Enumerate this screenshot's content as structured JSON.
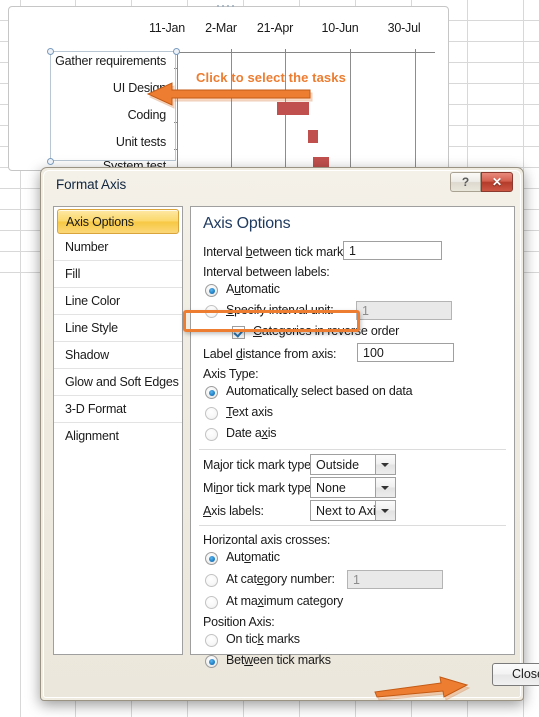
{
  "chart": {
    "callout": "Click to select the tasks",
    "x_axis_labels": [
      "11-Jan",
      "2-Mar",
      "21-Apr",
      "10-Jun",
      "30-Jul"
    ],
    "category_labels": [
      "Gather requirements",
      "UI Design",
      "Coding",
      "Unit tests",
      "System test"
    ],
    "bar_color": "#c0504d",
    "accent_color": "#ED7D31"
  },
  "chart_data": {
    "type": "bar",
    "title": "",
    "categories": [
      "Gather requirements",
      "UI Design",
      "Coding",
      "Unit tests",
      "System test"
    ],
    "values": [
      0,
      0,
      30,
      10,
      14
    ],
    "xlabel": "",
    "ylabel": "",
    "tick_labels": [
      "11-Jan",
      "2-Mar",
      "21-Apr",
      "10-Jun",
      "30-Jul"
    ],
    "grid": true,
    "legend": "none"
  },
  "dialog": {
    "title": "Format Axis",
    "help_label": "?",
    "close_x_label": "✕",
    "close_label": "Close",
    "nav": {
      "items": [
        {
          "label": "Axis Options",
          "selected": true
        },
        {
          "label": "Number",
          "selected": false
        },
        {
          "label": "Fill",
          "selected": false
        },
        {
          "label": "Line Color",
          "selected": false
        },
        {
          "label": "Line Style",
          "selected": false
        },
        {
          "label": "Shadow",
          "selected": false
        },
        {
          "label": "Glow and Soft Edges",
          "selected": false
        },
        {
          "label": "3-D Format",
          "selected": false
        },
        {
          "label": "Alignment",
          "selected": false
        }
      ]
    },
    "pane": {
      "heading": "Axis Options",
      "interval_tick_label": "Interval between tick marks:",
      "interval_tick_value": "1",
      "interval_labels_label": "Interval between labels:",
      "interval_labels_automatic": "Automatic",
      "interval_labels_specify": "Specify interval unit:",
      "interval_labels_specify_value": "1",
      "categories_reverse": "Categories in reverse order",
      "label_distance_label": "Label distance from axis:",
      "label_distance_value": "100",
      "axis_type_label": "Axis Type:",
      "axis_type_auto": "Automatically select based on data",
      "axis_type_text": "Text axis",
      "axis_type_date": "Date axis",
      "major_tick_label": "Major tick mark type:",
      "major_tick_value": "Outside",
      "minor_tick_label": "Minor tick mark type:",
      "minor_tick_value": "None",
      "axis_labels_label": "Axis labels:",
      "axis_labels_value": "Next to Axis",
      "hcross_label": "Horizontal axis crosses:",
      "hcross_auto": "Automatic",
      "hcross_category": "At category number:",
      "hcross_category_value": "1",
      "hcross_max": "At maximum category",
      "position_axis_label": "Position Axis:",
      "position_on": "On tick marks",
      "position_between": "Between tick marks"
    }
  }
}
